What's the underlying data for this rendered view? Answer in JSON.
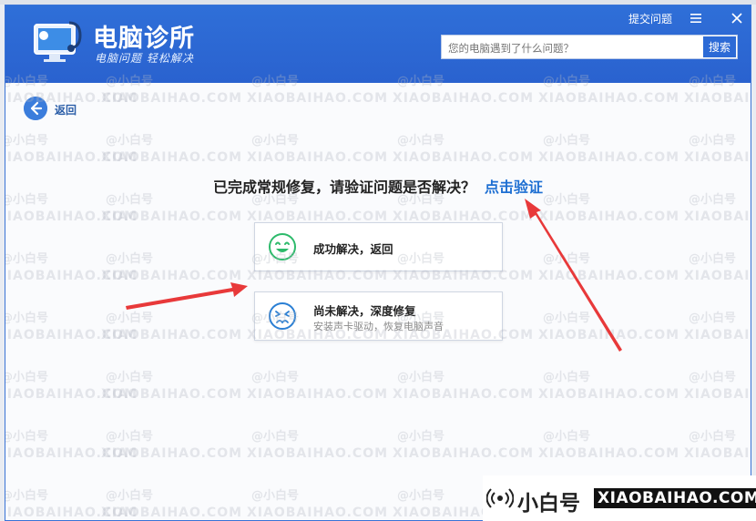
{
  "header": {
    "app_title": "电脑诊所",
    "app_subtitle": "电脑问题 轻松解决",
    "top_link": "提交问题",
    "menu_icon": "menu-icon",
    "close_icon": "close-icon"
  },
  "search": {
    "placeholder": "您的电脑遇到了什么问题？",
    "button_label": "搜索"
  },
  "back": {
    "label": "返回",
    "icon": "arrow-left-icon"
  },
  "main": {
    "question": "已完成常规修复，请验证问题是否解决？",
    "verify_link": "点击验证",
    "options": [
      {
        "title": "成功解决，返回",
        "subtitle": "",
        "icon": "smile-face-icon",
        "color": "#2dba6b"
      },
      {
        "title": "尚未解决，深度修复",
        "subtitle": "安装声卡驱动，恢复电脑声音",
        "icon": "sad-face-icon",
        "color": "#2a7fd4"
      }
    ]
  },
  "watermark": {
    "brand_cn": "@小白号",
    "brand_en": "XIAOBAIHAO.COM"
  },
  "brand_badge": {
    "cn": "小白号",
    "en": "XIAOBAIHAO.COM",
    "icon": "broadcast-icon"
  },
  "colors": {
    "title_bar": "#2f6fd8",
    "accent": "#1e6fd2",
    "arrow": "#e8393a"
  }
}
